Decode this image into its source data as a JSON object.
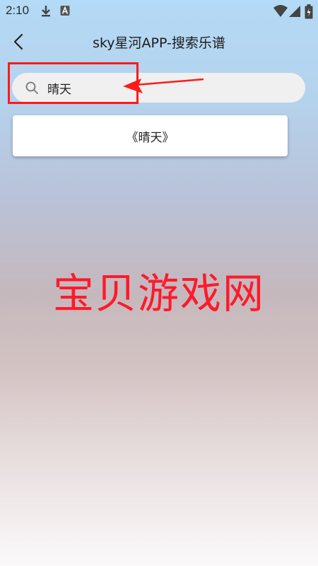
{
  "status_bar": {
    "time": "2:10"
  },
  "header": {
    "title": "sky星河APP-搜索乐谱"
  },
  "search": {
    "value": "晴天",
    "placeholder": ""
  },
  "results": [
    {
      "label": "《晴天》"
    }
  ],
  "watermark": {
    "text": "宝贝游戏网"
  },
  "icons": {
    "download": "download-icon",
    "app_notification": "a-notification-icon",
    "wifi": "wifi-icon",
    "signal": "signal-icon",
    "battery": "battery-icon",
    "back": "chevron-left-icon",
    "search": "search-icon"
  },
  "colors": {
    "annotation": "#ff1a1a",
    "watermark": "#ff1a2a"
  }
}
